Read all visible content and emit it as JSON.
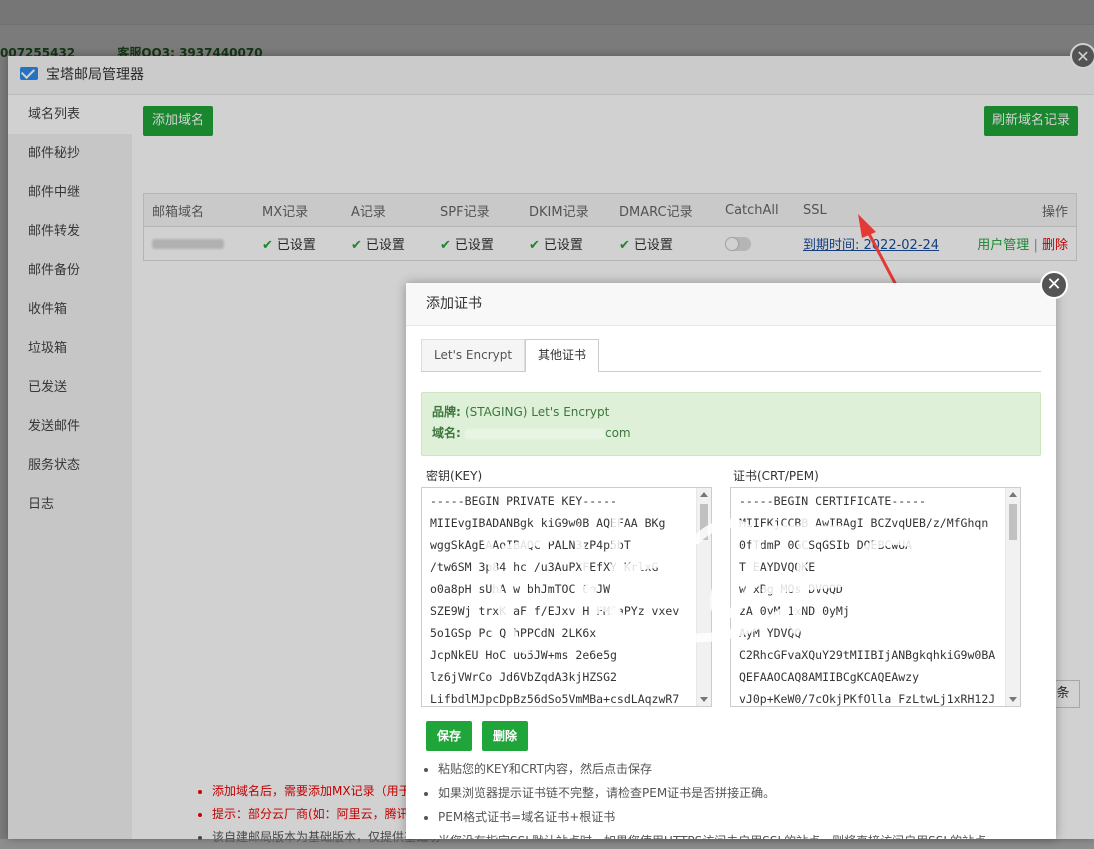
{
  "background": {
    "contact_phone": "007255432",
    "contact_qq": "客服QQ3: 3937440070"
  },
  "window": {
    "title": "宝塔邮局管理器",
    "close_glyph": "✕",
    "sidebar": {
      "items": [
        {
          "label": "域名列表"
        },
        {
          "label": "邮件秘抄"
        },
        {
          "label": "邮件中继"
        },
        {
          "label": "邮件转发"
        },
        {
          "label": "邮件备份"
        },
        {
          "label": "收件箱"
        },
        {
          "label": "垃圾箱"
        },
        {
          "label": "已发送"
        },
        {
          "label": "发送邮件"
        },
        {
          "label": "服务状态"
        },
        {
          "label": "日志"
        }
      ]
    },
    "add_domain_label": "添加域名",
    "refresh_label": "刷新域名记录",
    "table": {
      "headers": {
        "domain": "邮箱域名",
        "mx": "MX记录",
        "a": "A记录",
        "spf": "SPF记录",
        "dkim": "DKIM记录",
        "dmarc": "DMARC记录",
        "catchall": "CatchAll",
        "ssl": "SSL",
        "ops": "操作"
      },
      "row": {
        "mx": "已设置",
        "a": "已设置",
        "spf": "已设置",
        "dkim": "已设置",
        "dmarc": "已设置",
        "ssl": "到期时间: 2022-02-24",
        "user_mgmt": "用户管理",
        "separator": "|",
        "delete": "删除"
      }
    },
    "notes": [
      "添加域名后，需要添加MX记录（用于邮箱",
      "提示：部分云厂商(如：阿里云，腾讯云)默",
      "该自建邮局版本为基础版本，仅提供基础功"
    ],
    "bg_fragment": "条"
  },
  "dialog": {
    "title": "添加证书",
    "close_glyph": "✕",
    "tabs": [
      {
        "label": "Let's Encrypt",
        "active": false
      },
      {
        "label": "其他证书",
        "active": true
      }
    ],
    "info": {
      "brand_label": "品牌: ",
      "brand_value": "(STAGING) Let's Encrypt",
      "domain_label": "域名: ",
      "domain_value": "com"
    },
    "key_label": "密钥(KEY)",
    "cert_label": "证书(CRT/PEM)",
    "key_lines": [
      "-----BEGIN PRIVATE KEY-----",
      "MIIEvgIBADANBgk  kiG9w0B      AQEFAA  BKg",
      "wggSkAgEAAoIBAQC   PALN3zP4p5bT",
      "/tw6SM  3p84  hc    /u3AuPXFEfXY     KrlxG",
      "o0a8pH  sUhA   w bhJmTOC  6oJW",
      "SZE9Wj   trxK  aF  f/EJxv  H  FM5aPYz  vxev",
      "5o1GSp    Pc  Q  hPPCdN   2LK6x",
      "JcpNkEU  HoC  u65JW+ms       2e6e5g",
      "lz6jVWrCo   Jd6VbZqdA3kjHZSG2",
      "LifbdlMJpcDpBz56dSo5VmMBa+csdLAqzwR7"
    ],
    "cert_lines": [
      "-----BEGIN CERTIFICATE-----",
      "MIIFKjCCBB   AwIBAgI  BCZvqUEB/z/MfGhqn",
      "0fTdmP   0GCSqGSIb  DQEBCwUA",
      "                 T     EAYDVQQKE",
      "w           xBg  MOs    DVQQD",
      "          zA    0yM      1xND   0yMj",
      "AyM                 YDVQQ",
      "C2RhcGFvaXQuY29tMIIBIjANBgkqhkiG9w0BA",
      "QEFAAOCAQ8AMIIBCgKCAQEAwzy",
      "vJ0p+KeW0/7cOkjPKfOlla  FzLtwLj1xRH12J"
    ],
    "save_label": "保存",
    "delete_label": "删除",
    "notes": [
      "粘贴您的KEY和CRT内容，然后点击保存",
      "如果浏览器提示证书链不完整，请检查PEM证书是否拼接正确。",
      "PEM格式证书=域名证书+根证书",
      "当您没有指定SSL默认站点时，如果您使用HTTPS访问未启用SSL的站点，则将直接访问启用SSL的站点"
    ]
  }
}
